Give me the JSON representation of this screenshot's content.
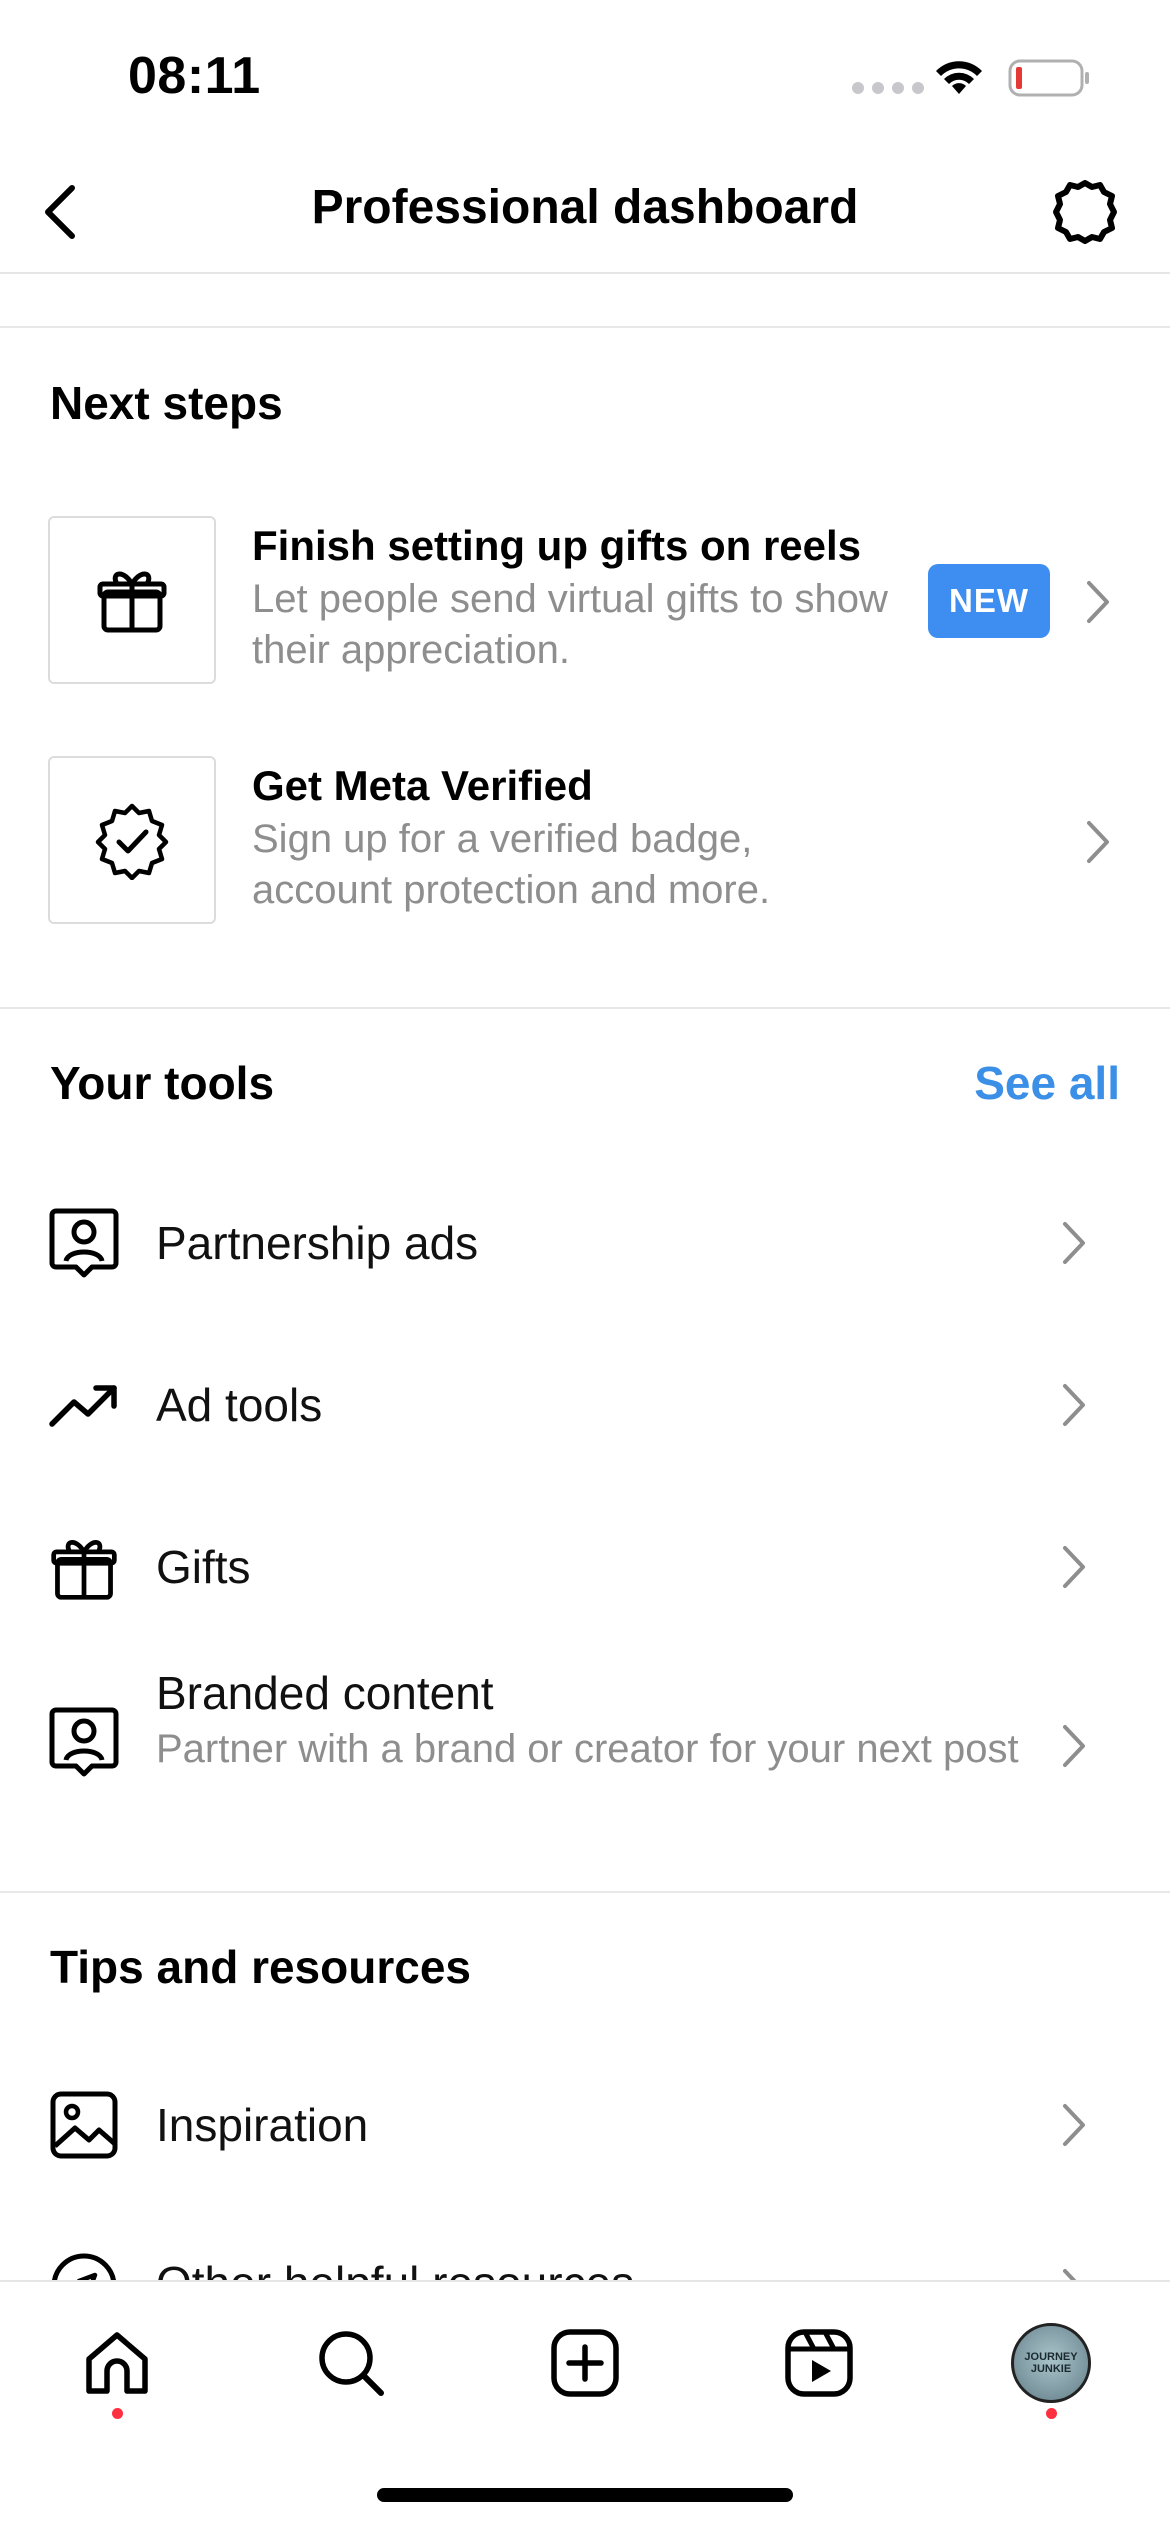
{
  "status_bar": {
    "time": "08:11"
  },
  "header": {
    "title": "Professional dashboard"
  },
  "next_steps": {
    "title": "Next steps",
    "items": [
      {
        "title": "Finish setting up gifts on reels",
        "description": "Let people send virtual gifts to show their appreciation.",
        "badge": "NEW",
        "icon": "gift-icon"
      },
      {
        "title": "Get Meta Verified",
        "description": "Sign up for a verified badge, account protection and more.",
        "icon": "verified-badge-icon"
      }
    ]
  },
  "your_tools": {
    "title": "Your tools",
    "see_all": "See all",
    "items": [
      {
        "label": "Partnership ads",
        "icon": "person-card-icon"
      },
      {
        "label": "Ad tools",
        "icon": "trending-up-icon"
      },
      {
        "label": "Gifts",
        "icon": "gift-icon"
      },
      {
        "label": "Branded content",
        "description": "Partner with a brand or creator for your next post",
        "icon": "person-card-icon"
      }
    ]
  },
  "tips": {
    "title": "Tips and resources",
    "items": [
      {
        "label": "Inspiration",
        "icon": "image-icon"
      },
      {
        "label": "Other helpful resources",
        "icon": "compass-icon"
      }
    ]
  },
  "bottom_nav": {
    "items": [
      "home-icon",
      "search-icon",
      "create-icon",
      "reels-icon",
      "profile-avatar"
    ],
    "avatar_text": "JOURNEY JUNKIE"
  },
  "colors": {
    "accent": "#3b8fe6",
    "badge": "#3d8ef0",
    "notification_dot": "#ff3040",
    "secondary_text": "#8e8e8e"
  }
}
